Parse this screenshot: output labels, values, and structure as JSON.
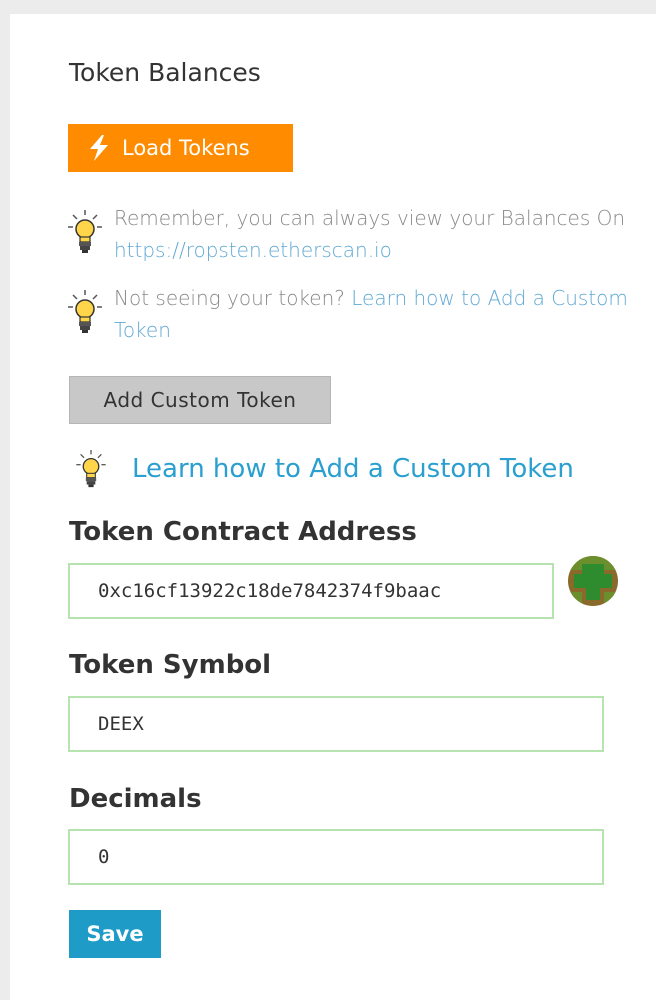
{
  "header": {
    "title": "Token Balances"
  },
  "load_button": {
    "label": "Load Tokens",
    "icon": "lightning-bolt-icon",
    "color": "#ff8c00"
  },
  "tips": [
    {
      "text": "Remember, you can always view your Balances On ",
      "link": "https://ropsten.etherscan.io"
    },
    {
      "text": "Not seeing your token? ",
      "link": "Learn how to Add a Custom Token"
    }
  ],
  "custom_token_button": {
    "label": "Add Custom Token"
  },
  "learn_link": {
    "label": "Learn how to Add a Custom Token",
    "icon": "lightbulb-icon"
  },
  "form": {
    "address": {
      "label": "Token Contract Address",
      "value": "0xc16cf13922c18de7842374f9baac"
    },
    "symbol": {
      "label": "Token Symbol",
      "value": "DEEX"
    },
    "decimals": {
      "label": "Decimals",
      "value": "0"
    }
  },
  "save_button": {
    "label": "Save",
    "color": "#1e9bc7"
  }
}
